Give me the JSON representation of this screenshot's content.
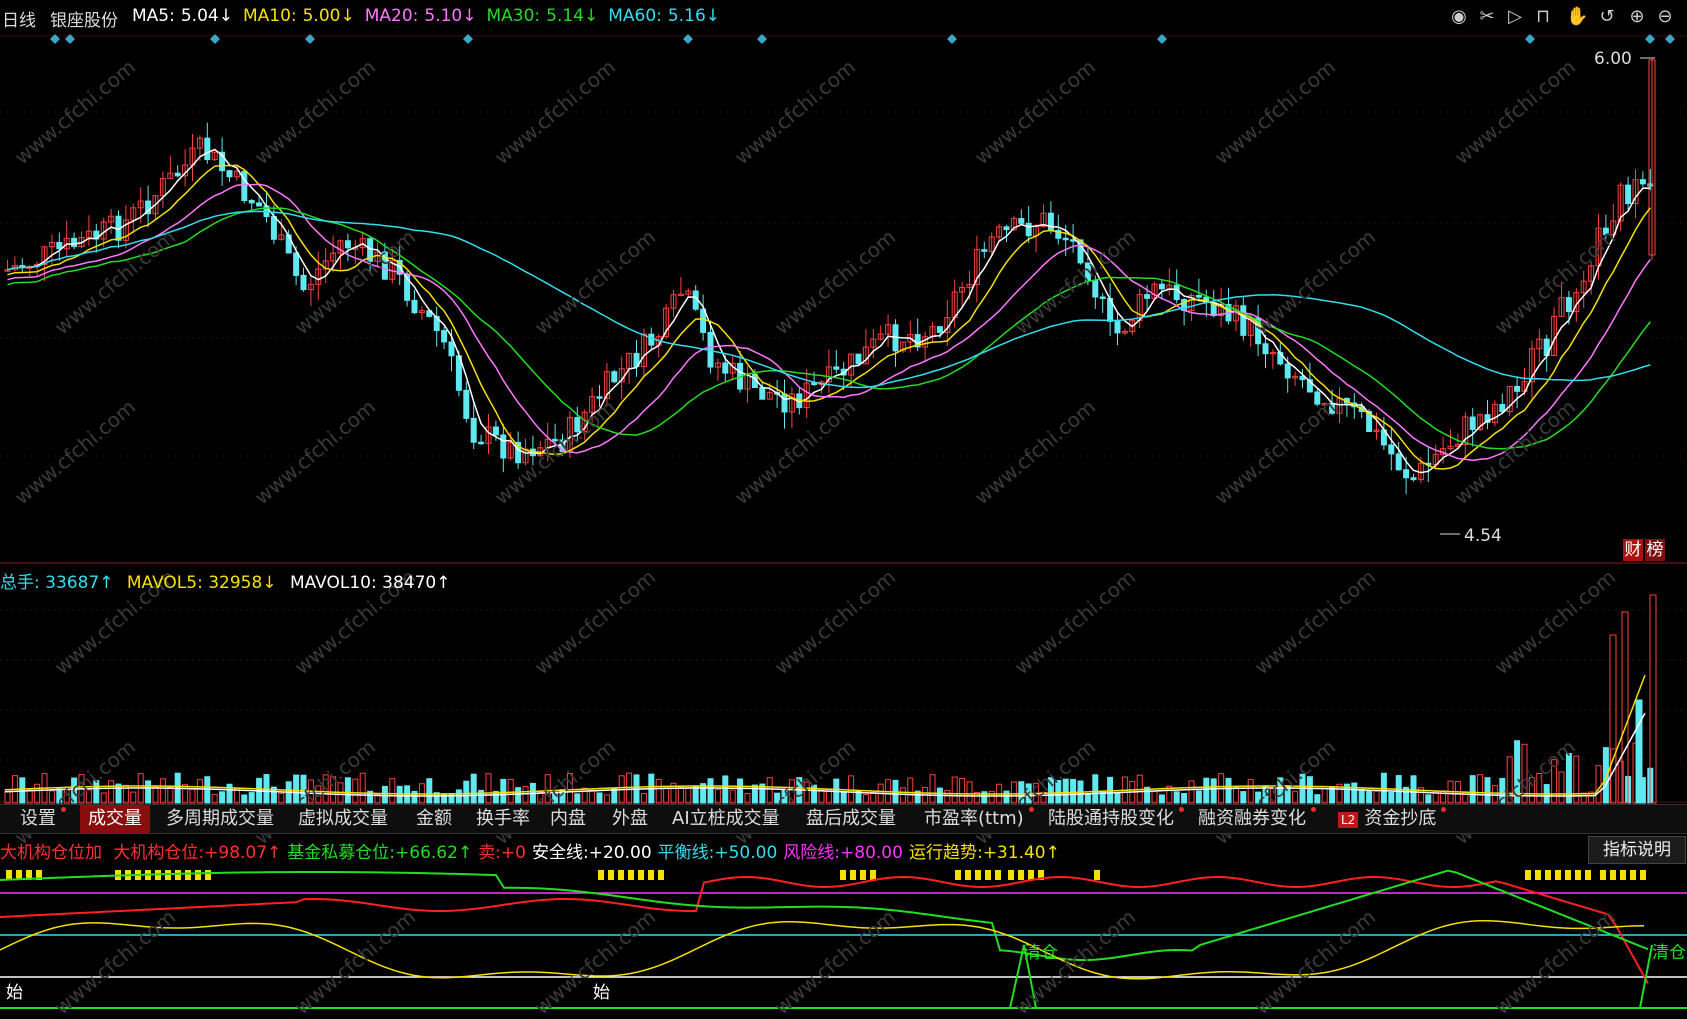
{
  "header": {
    "period": "日线",
    "stock": "银座股份",
    "ma": [
      {
        "label": "MA5:",
        "value": "5.04↓",
        "color": "#ffffff"
      },
      {
        "label": "MA10:",
        "value": "5.00↓",
        "color": "#f5e000"
      },
      {
        "label": "MA20:",
        "value": "5.10↓",
        "color": "#ff77ff"
      },
      {
        "label": "MA30:",
        "value": "5.14↓",
        "color": "#22dd22"
      },
      {
        "label": "MA60:",
        "value": "5.16↓",
        "color": "#33ddee"
      }
    ]
  },
  "toolbar": [
    "eye-icon",
    "scissors-icon",
    "play-icon",
    "lock-icon",
    "hand-icon",
    "undo-icon",
    "zoom-in-icon",
    "zoom-out-icon"
  ],
  "price_chart": {
    "high_label": "6.00",
    "low_label": "4.54",
    "badges": [
      "财",
      "榜"
    ]
  },
  "volume": {
    "total_label": "总手:",
    "total_value": "33687↑",
    "mavol5_label": "MAVOL5:",
    "mavol5_value": "32958↓",
    "mavol10_label": "MAVOL10:",
    "mavol10_value": "38470↑"
  },
  "tabs": [
    {
      "label": "设置",
      "active": false,
      "dot": true
    },
    {
      "label": "成交量",
      "active": true,
      "dot": false
    },
    {
      "label": "多周期成交量",
      "active": false,
      "dot": false
    },
    {
      "label": "虚拟成交量",
      "active": false,
      "dot": false
    },
    {
      "label": "金额",
      "active": false,
      "dot": false
    },
    {
      "label": "换手率",
      "active": false,
      "dot": false
    },
    {
      "label": "内盘",
      "active": false,
      "dot": false
    },
    {
      "label": "外盘",
      "active": false,
      "dot": false
    },
    {
      "label": "AI立桩成交量",
      "active": false,
      "dot": false
    },
    {
      "label": "盘后成交量",
      "active": false,
      "dot": false
    },
    {
      "label": "市盈率(ttm)",
      "active": false,
      "dot": true
    },
    {
      "label": "陆股通持股变化",
      "active": false,
      "dot": true
    },
    {
      "label": "融资融券变化",
      "active": false,
      "dot": true
    },
    {
      "label": "资金抄底",
      "active": false,
      "dot": true,
      "badge": "L2"
    }
  ],
  "indicator": {
    "name": "大机构仓位加",
    "items": [
      {
        "label": "大机构仓位:",
        "value": "+98.07↑",
        "color": "#ff3030"
      },
      {
        "label": "基金私募仓位:",
        "value": "+66.62↑",
        "color": "#22dd22"
      },
      {
        "label": "卖:",
        "value": "+0",
        "color": "#ff3030"
      },
      {
        "label": "安全线:",
        "value": "+20.00",
        "color": "#ffffff"
      },
      {
        "label": "平衡线:",
        "value": "+50.00",
        "color": "#33ddee"
      },
      {
        "label": "风险线:",
        "value": "+80.00",
        "color": "#ff33ff"
      },
      {
        "label": "运行趋势:",
        "value": "+31.40↑",
        "color": "#f5e000"
      }
    ],
    "help_button": "指标说明",
    "markers": [
      "始",
      "始",
      "清仓",
      "清仓"
    ]
  }
}
